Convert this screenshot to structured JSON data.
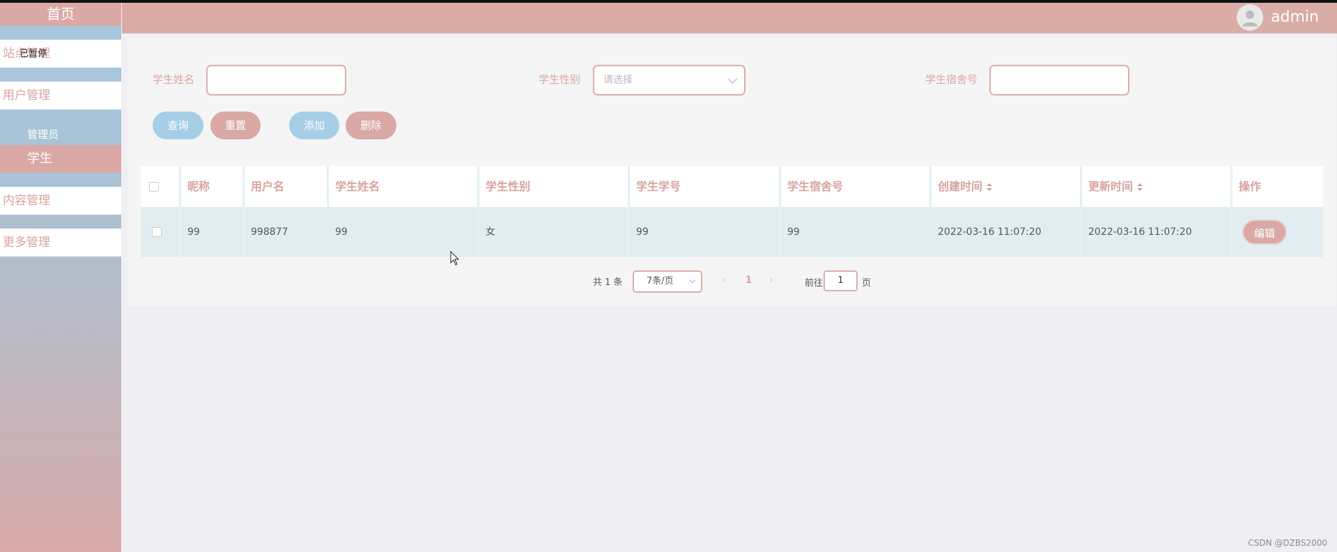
{
  "sidebar": {
    "home": "首页",
    "overlay_text": "已暂停",
    "groups": [
      {
        "label": "站点管理"
      },
      {
        "label": "用户管理"
      },
      {
        "label": "内容管理"
      },
      {
        "label": "更多管理"
      }
    ],
    "sub_items": [
      {
        "label": "管理员"
      },
      {
        "label": "学生"
      }
    ]
  },
  "header": {
    "username": "admin"
  },
  "filters": {
    "name_label": "学生姓名",
    "gender_label": "学生性别",
    "gender_placeholder": "请选择",
    "dorm_label": "学生宿舍号"
  },
  "actions": {
    "query": "查询",
    "reset": "重置",
    "add": "添加",
    "delete": "删除"
  },
  "table": {
    "columns": [
      "昵称",
      "用户名",
      "学生姓名",
      "学生性别",
      "学生学号",
      "学生宿舍号",
      "创建时间",
      "更新时间",
      "操作"
    ],
    "rows": [
      {
        "nickname": "99",
        "username": "998877",
        "name": "99",
        "gender": "女",
        "student_no": "99",
        "dorm": "99",
        "created": "2022-03-16 11:07:20",
        "updated": "2022-03-16 11:07:20",
        "edit": "编辑"
      }
    ]
  },
  "pagination": {
    "total": "共 1 条",
    "page_size": "7条/页",
    "current_page": "1",
    "goto_prefix": "前往",
    "goto_value": "1",
    "goto_suffix": "页"
  },
  "watermark": "CSDN @DZBS2000"
}
